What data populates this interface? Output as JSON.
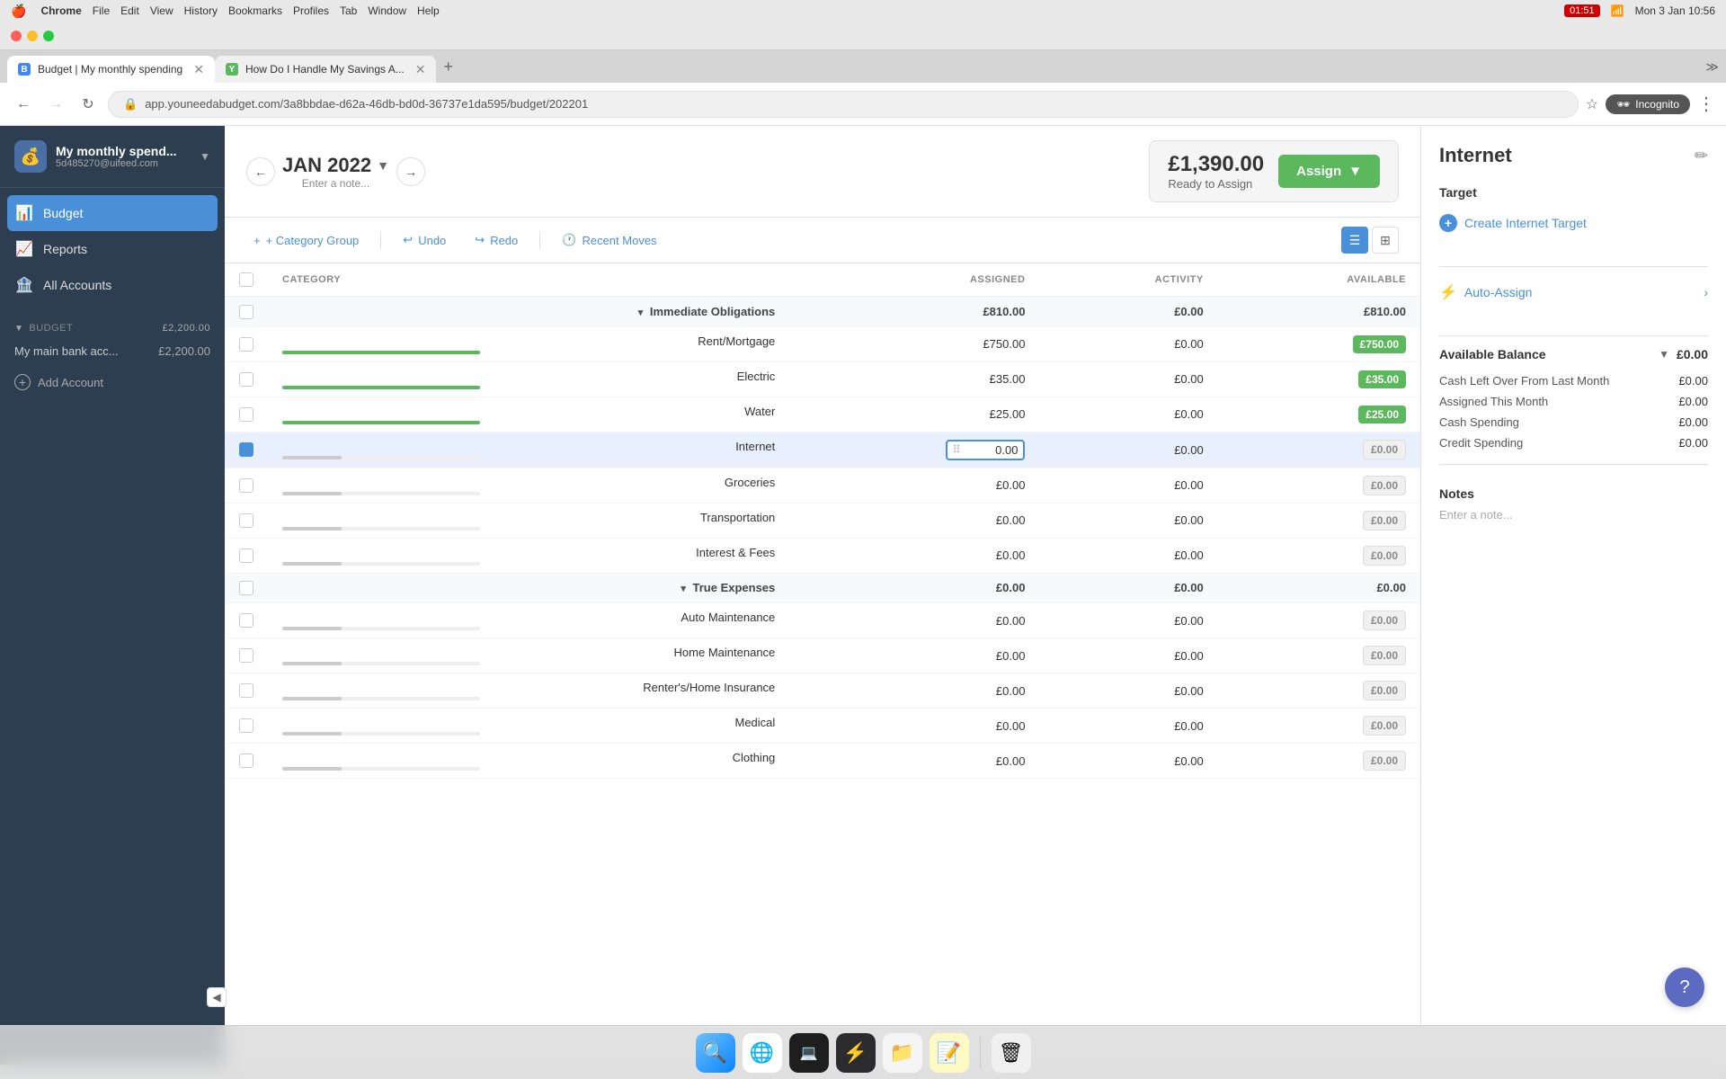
{
  "system": {
    "time": "10:56",
    "date": "Mon 3 Jan",
    "battery": "01:51"
  },
  "browser": {
    "app_name": "Chrome",
    "menu_items": [
      "Chrome",
      "File",
      "Edit",
      "View",
      "History",
      "Bookmarks",
      "Profiles",
      "Tab",
      "Window",
      "Help"
    ],
    "tabs": [
      {
        "id": "tab1",
        "title": "Budget | My monthly spending",
        "active": true,
        "favicon": "B"
      },
      {
        "id": "tab2",
        "title": "How Do I Handle My Savings A...",
        "active": false,
        "favicon": "Y"
      }
    ],
    "url": "app.youneedabudget.com/3a8bbdae-d62a-46db-bd0d-36737e1da595/budget/202201",
    "profile": "Incognito"
  },
  "sidebar": {
    "logo_text": "💰",
    "budget_name": "My monthly spend...",
    "budget_id": "5d485270@uifeed.com",
    "chevron": "▼",
    "nav_items": [
      {
        "id": "budget",
        "label": "Budget",
        "icon": "📊",
        "active": true
      },
      {
        "id": "reports",
        "label": "Reports",
        "icon": "📈",
        "active": false
      },
      {
        "id": "all-accounts",
        "label": "All Accounts",
        "icon": "🏦",
        "active": false
      }
    ],
    "section_label": "BUDGET",
    "section_amount": "£2,200.00",
    "section_chevron": "▼",
    "account_name": "My main bank acc...",
    "account_amount": "£2,200.00",
    "add_account_label": "Add Account"
  },
  "budget_header": {
    "prev_label": "←",
    "next_label": "→",
    "month": "JAN 2022",
    "month_chevron": "▼",
    "note_placeholder": "Enter a note...",
    "ready_amount": "£1,390.00",
    "ready_label": "Ready to Assign",
    "assign_btn_label": "Assign",
    "assign_btn_chevron": "▼"
  },
  "toolbar": {
    "category_group_label": "+ Category Group",
    "undo_label": "Undo",
    "redo_label": "Redo",
    "recent_moves_label": "Recent Moves",
    "view_list_active": true
  },
  "table": {
    "headers": {
      "category": "CATEGORY",
      "assigned": "ASSIGNED",
      "activity": "ACTIVITY",
      "available": "AVAILABLE"
    },
    "groups": [
      {
        "id": "immediate",
        "name": "Immediate Obligations",
        "assigned": "£810.00",
        "activity": "£0.00",
        "available": "£810.00",
        "expanded": true,
        "categories": [
          {
            "id": "rent",
            "name": "Rent/Mortgage",
            "assigned": "£750.00",
            "activity": "£0.00",
            "available": "£750.00",
            "available_class": "green",
            "progress": 100,
            "selected": false
          },
          {
            "id": "electric",
            "name": "Electric",
            "assigned": "£35.00",
            "activity": "£0.00",
            "available": "£35.00",
            "available_class": "green",
            "progress": 100,
            "selected": false
          },
          {
            "id": "water",
            "name": "Water",
            "assigned": "£25.00",
            "activity": "£0.00",
            "available": "£25.00",
            "available_class": "green",
            "progress": 100,
            "selected": false
          },
          {
            "id": "internet",
            "name": "Internet",
            "assigned": "0.00",
            "activity": "£0.00",
            "available": "£0.00",
            "available_class": "gray",
            "progress": 0,
            "selected": true
          },
          {
            "id": "groceries",
            "name": "Groceries",
            "assigned": "£0.00",
            "activity": "£0.00",
            "available": "£0.00",
            "available_class": "gray",
            "progress": 0,
            "selected": false
          },
          {
            "id": "transportation",
            "name": "Transportation",
            "assigned": "£0.00",
            "activity": "£0.00",
            "available": "£0.00",
            "available_class": "gray",
            "progress": 0,
            "selected": false
          },
          {
            "id": "interest",
            "name": "Interest & Fees",
            "assigned": "£0.00",
            "activity": "£0.00",
            "available": "£0.00",
            "available_class": "gray",
            "progress": 0,
            "selected": false
          }
        ]
      },
      {
        "id": "true-expenses",
        "name": "True Expenses",
        "assigned": "£0.00",
        "activity": "£0.00",
        "available": "£0.00",
        "expanded": true,
        "categories": [
          {
            "id": "auto",
            "name": "Auto Maintenance",
            "assigned": "£0.00",
            "activity": "£0.00",
            "available": "£0.00",
            "available_class": "gray",
            "progress": 0,
            "selected": false
          },
          {
            "id": "home-maint",
            "name": "Home Maintenance",
            "assigned": "£0.00",
            "activity": "£0.00",
            "available": "£0.00",
            "available_class": "gray",
            "progress": 0,
            "selected": false
          },
          {
            "id": "renters",
            "name": "Renter's/Home Insurance",
            "assigned": "£0.00",
            "activity": "£0.00",
            "available": "£0.00",
            "available_class": "gray",
            "progress": 0,
            "selected": false
          },
          {
            "id": "medical",
            "name": "Medical",
            "assigned": "£0.00",
            "activity": "£0.00",
            "available": "£0.00",
            "available_class": "gray",
            "progress": 0,
            "selected": false
          },
          {
            "id": "clothing",
            "name": "Clothing",
            "assigned": "£0.00",
            "activity": "£0.00",
            "available": "£0.00",
            "available_class": "gray",
            "progress": 0,
            "selected": false
          }
        ]
      }
    ]
  },
  "right_panel": {
    "title": "Internet",
    "edit_icon": "✏",
    "target_section": "Target",
    "create_target_label": "Create Internet Target",
    "auto_assign_label": "Auto-Assign",
    "available_balance_label": "Available Balance",
    "available_balance_chevron": "▼",
    "available_balance_amount": "£0.00",
    "cash_left_label": "Cash Left Over From Last Month",
    "cash_left_amount": "£0.00",
    "assigned_month_label": "Assigned This Month",
    "assigned_month_amount": "£0.00",
    "cash_spending_label": "Cash Spending",
    "cash_spending_amount": "£0.00",
    "credit_spending_label": "Credit Spending",
    "credit_spending_amount": "£0.00",
    "notes_label": "Notes",
    "notes_placeholder": "Enter a note..."
  },
  "help_btn": "?",
  "dock": {
    "items": [
      {
        "id": "finder",
        "icon": "🔍",
        "label": "Finder"
      },
      {
        "id": "chrome",
        "icon": "🌐",
        "label": "Chrome"
      },
      {
        "id": "terminal",
        "icon": "💻",
        "label": "Terminal"
      },
      {
        "id": "scripts",
        "icon": "⚡",
        "label": "Scripts"
      },
      {
        "id": "files",
        "icon": "📁",
        "label": "Files"
      },
      {
        "id": "notes",
        "icon": "📝",
        "label": "Notes"
      },
      {
        "id": "trash",
        "icon": "🗑",
        "label": "Trash"
      }
    ]
  }
}
